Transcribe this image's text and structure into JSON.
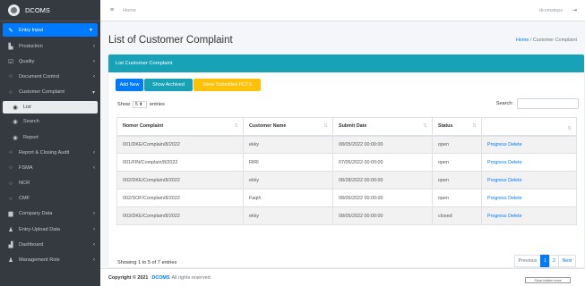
{
  "brand": {
    "name": "DCOMS"
  },
  "sidebar": {
    "items": [
      {
        "label": "Entry Input",
        "icon": "edit-icon",
        "glyph": "✎",
        "arrow": "▾",
        "state": "active"
      },
      {
        "label": "Production",
        "icon": "factory-icon",
        "glyph": "▙",
        "arrow": "‹",
        "state": ""
      },
      {
        "label": "Quality",
        "icon": "check-square-icon",
        "glyph": "☑",
        "arrow": "‹",
        "state": ""
      },
      {
        "label": "Document Control",
        "icon": "circle-icon",
        "glyph": "○",
        "arrow": "‹",
        "state": ""
      },
      {
        "label": "Customer Complaint",
        "icon": "circle-icon",
        "glyph": "○",
        "arrow": "▾",
        "state": ""
      },
      {
        "label": "List",
        "icon": "dot-circle-icon",
        "glyph": "◉",
        "arrow": "",
        "state": "sub-active"
      },
      {
        "label": "Search",
        "icon": "dot-circle-icon",
        "glyph": "◉",
        "arrow": "",
        "state": "sub"
      },
      {
        "label": "Report",
        "icon": "dot-circle-icon",
        "glyph": "◉",
        "arrow": "",
        "state": "sub"
      },
      {
        "label": "Report & Closing Audit",
        "icon": "circle-icon",
        "glyph": "○",
        "arrow": "‹",
        "state": ""
      },
      {
        "label": "FSMA",
        "icon": "circle-icon",
        "glyph": "○",
        "arrow": "‹",
        "state": ""
      },
      {
        "label": "NCR",
        "icon": "circle-icon",
        "glyph": "○",
        "arrow": "",
        "state": ""
      },
      {
        "label": "CMF",
        "icon": "circle-icon",
        "glyph": "○",
        "arrow": "",
        "state": ""
      },
      {
        "label": "Company Data",
        "icon": "building-icon",
        "glyph": "▆",
        "arrow": "‹",
        "state": ""
      },
      {
        "label": "Entry-Upload Data",
        "icon": "users-icon",
        "glyph": "♟",
        "arrow": "‹",
        "state": ""
      },
      {
        "label": "Dashboard",
        "icon": "chart-icon",
        "glyph": "▟",
        "arrow": "‹",
        "state": ""
      },
      {
        "label": "Management Role",
        "icon": "user-group-icon",
        "glyph": "♟",
        "arrow": "‹",
        "state": ""
      }
    ]
  },
  "topbar": {
    "home_label": "Home",
    "user": "dcomsteps"
  },
  "page": {
    "title": "List of Customer Complaint",
    "breadcrumb_home": "Home",
    "breadcrumb_sep": "/",
    "breadcrumb_current": "Customer Complaint"
  },
  "card": {
    "header": "List Customer Complaint",
    "buttons": {
      "add": "Add New",
      "archived": "Show Archived",
      "submitted": "Show Submitted PCTS"
    },
    "show_label": "Show",
    "entries_value": "5",
    "entries_label": "entries",
    "search_label": "Search:"
  },
  "table": {
    "columns": [
      "Nomor Complaint",
      "Customer Name",
      "Submit Date",
      "Status",
      ""
    ],
    "rows": [
      {
        "nomor": "001/DKE/Complain/8/2022",
        "customer": "ekky",
        "date": "08/05/2022 00:00:00",
        "status": "open"
      },
      {
        "nomor": "001/FIN/Complain/8/2022",
        "customer": "RIRI",
        "date": "07/05/2022 00:00:00",
        "status": "open"
      },
      {
        "nomor": "002/DKE/Complain/8/2022",
        "customer": "ekky",
        "date": "08/28/2022 00:00:00",
        "status": "open"
      },
      {
        "nomor": "002/SOF/Complain/8/2022",
        "customer": "Faqih",
        "date": "08/05/2022 00:00:00",
        "status": "open"
      },
      {
        "nomor": "003/DKE/Complain/8/2022",
        "customer": "ekky",
        "date": "08/05/2022 00:00:00",
        "status": "closed"
      }
    ],
    "action_progress": "Progress",
    "action_delete": "Delete",
    "info": "Showing 1 to 5 of 7 entries"
  },
  "pagination": {
    "previous": "Previous",
    "pages": [
      "1",
      "2"
    ],
    "current": "1",
    "next": "Next"
  },
  "footer": {
    "copyright": "Copyright © 2021",
    "brand": "DCOMS",
    "rights": "All rights reserved."
  },
  "hidden_button": "Show hidden icons",
  "colors": {
    "sidebar": "#343a40",
    "primary": "#007bff",
    "info": "#17a2b8",
    "warning": "#ffc107"
  }
}
